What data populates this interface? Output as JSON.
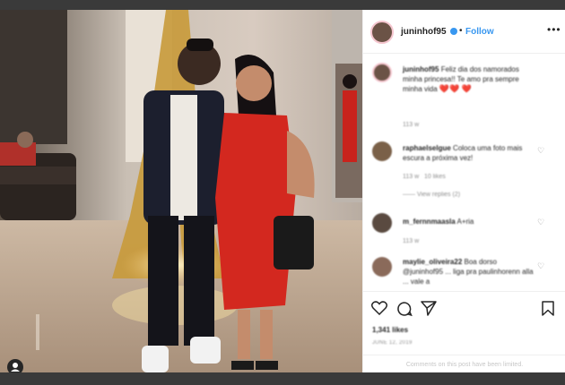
{
  "post": {
    "username": "juninhof95",
    "follow_label": "Follow",
    "separator": "•",
    "more_label": "•••"
  },
  "comments": [
    {
      "username": "juninhof95",
      "text": "Feliz dia dos namorados minha princesa!! Te amo pra sempre minha vida",
      "hearts": "❤️❤️",
      "trailing": "❤️",
      "time": "113 w"
    },
    {
      "username": "raphaelselgue",
      "text": "Coloca uma foto mais escura a próxima vez!",
      "time": "113 w",
      "likes": "10 likes",
      "replies": "—— View replies (2)"
    },
    {
      "username": "m_fernnmaasla",
      "text": "A+ria",
      "time": "113 w"
    },
    {
      "username": "maylie_oliveira22",
      "text": "Boa dorso @juninhof95 ... liga pra paulinhorenn alla ... vale a",
      "mention": "@juninhof95"
    }
  ],
  "actions": {
    "likes": "1,341 likes",
    "date": "JUNE 12, 2019",
    "limited_notice": "Comments on this post have been limited."
  },
  "colors": {
    "link_blue": "#3897f0",
    "heart_red": "#ed4956",
    "muted_gray": "#8e8e8e"
  }
}
